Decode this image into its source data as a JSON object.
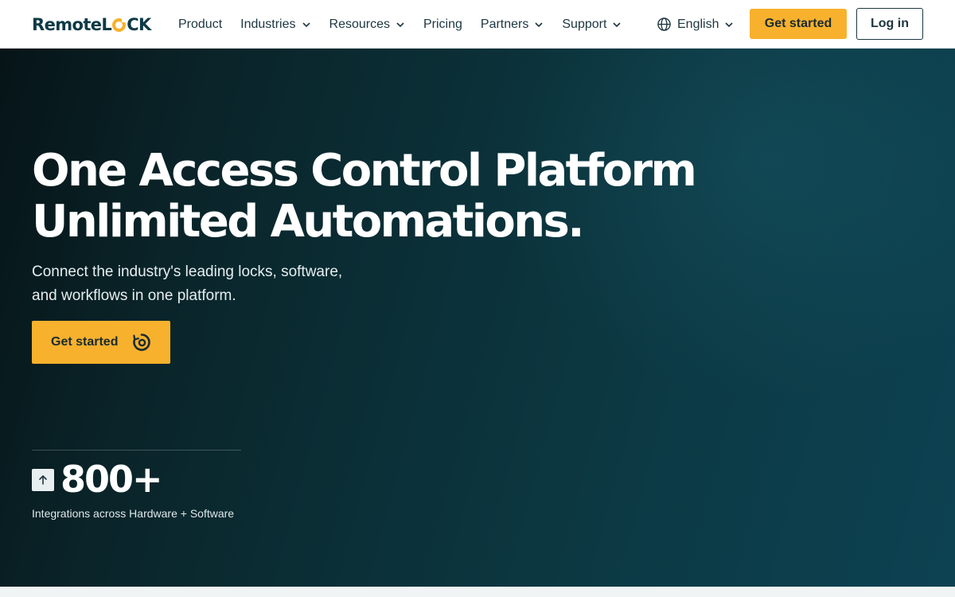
{
  "brand": {
    "logo_prefix": "Remote",
    "logo_suffix": "CK",
    "logo_letter": "L"
  },
  "nav": {
    "items": [
      {
        "label": "Product",
        "has_dropdown": false
      },
      {
        "label": "Industries",
        "has_dropdown": true
      },
      {
        "label": "Resources",
        "has_dropdown": true
      },
      {
        "label": "Pricing",
        "has_dropdown": false
      },
      {
        "label": "Partners",
        "has_dropdown": true
      },
      {
        "label": "Support",
        "has_dropdown": true
      }
    ],
    "language": "English",
    "cta": "Get started",
    "login": "Log in"
  },
  "hero": {
    "headline_line1": "One Access Control Platform",
    "headline_line2": "Unlimited Automations.",
    "sub_line1": "Connect the industry's leading locks, software,",
    "sub_line2": "and workflows in one platform.",
    "cta": "Get started",
    "stat_number": "800+",
    "stat_label": "Integrations across Hardware + Software"
  },
  "colors": {
    "accent": "#f7b12d",
    "nav_text": "#1c3640",
    "hero_dark": "#061417",
    "hero_teal": "#0d4252",
    "logo": "#0d3a46"
  },
  "icons": {
    "chevron": "chevron-down-icon",
    "language": "globe-icon",
    "cta": "spinner-icon",
    "stat": "arrow-up-icon"
  }
}
